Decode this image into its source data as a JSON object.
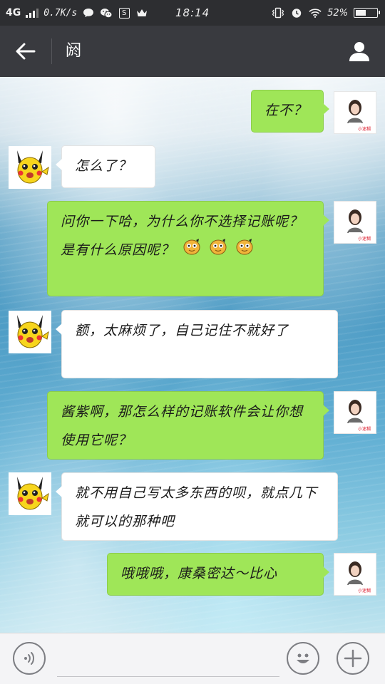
{
  "status_bar": {
    "network": "4G",
    "speed": "0.7K/s",
    "time": "18:14",
    "battery_percent": 52,
    "battery_text": "52%"
  },
  "title_bar": {
    "title": "阏",
    "back_icon": "back-arrow-icon",
    "profile_icon": "person-icon"
  },
  "messages": [
    {
      "sender": "me",
      "text": "在不？"
    },
    {
      "sender": "other",
      "text": "怎么了？"
    },
    {
      "sender": "me",
      "text": "问你一下哈，为什么你不选择记账呢？是有什么原因呢？",
      "emoji_count": 3
    },
    {
      "sender": "other",
      "text": "额，太麻烦了，自己记住不就好了"
    },
    {
      "sender": "me",
      "text": "酱紫啊，那怎么样的记账软件会让你想使用它呢？"
    },
    {
      "sender": "other",
      "text": "就不用自己写太多东西的呗，就点几下就可以的那种吧"
    },
    {
      "sender": "me",
      "text": "哦哦哦，康桑密达～比心"
    }
  ],
  "input_bar": {
    "voice_icon": "voice-icon",
    "emoji_icon": "smiley-icon",
    "plus_icon": "plus-icon",
    "input_value": ""
  },
  "colors": {
    "title_bar": "#393a3f",
    "my_bubble": "#9fe658",
    "other_bubble": "#ffffff"
  }
}
